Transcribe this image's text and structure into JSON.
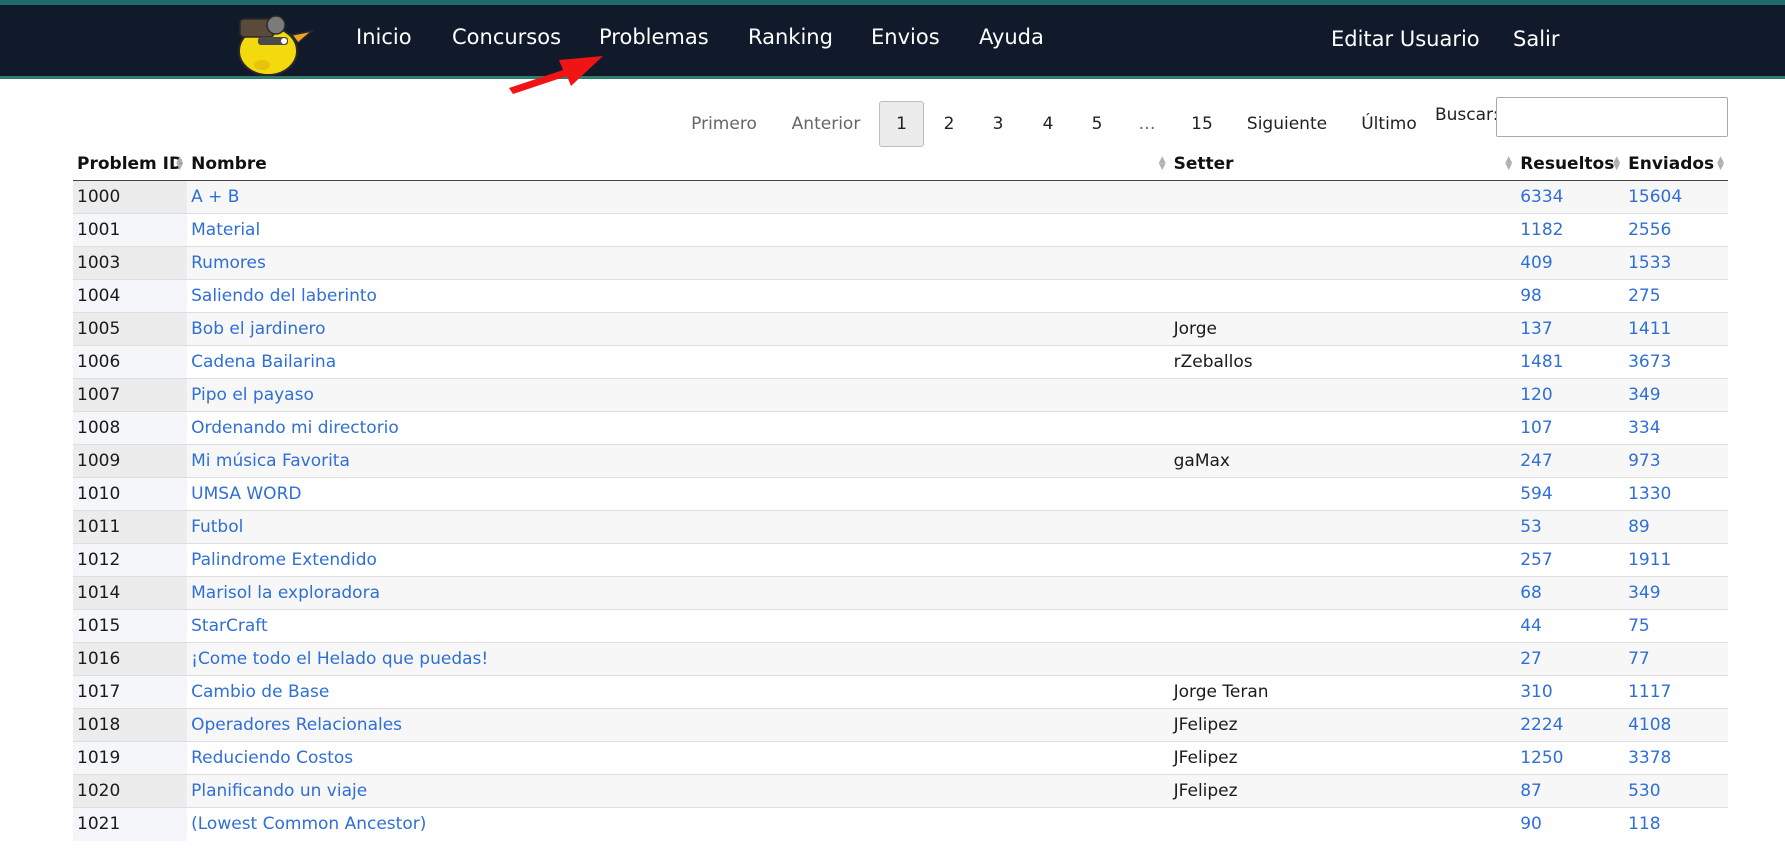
{
  "nav": {
    "links": [
      "Inicio",
      "Concursos",
      "Problemas",
      "Ranking",
      "Envios",
      "Ayuda"
    ],
    "edit_user": "Editar Usuario",
    "logout": "Salir"
  },
  "pagination": {
    "first": "Primero",
    "previous": "Anterior",
    "pages": [
      "1",
      "2",
      "3",
      "4",
      "5",
      "…",
      "15"
    ],
    "next": "Siguiente",
    "last": "Último"
  },
  "search": {
    "label": "Buscar:",
    "value": ""
  },
  "table": {
    "headers": [
      "Problem ID",
      "Nombre",
      "Setter",
      "Resueltos",
      "Enviados"
    ],
    "rows": [
      {
        "id": "1000",
        "name": "A + B",
        "setter": "",
        "solved": "6334",
        "sent": "15604"
      },
      {
        "id": "1001",
        "name": "Material",
        "setter": "",
        "solved": "1182",
        "sent": "2556"
      },
      {
        "id": "1003",
        "name": "Rumores",
        "setter": "",
        "solved": "409",
        "sent": "1533"
      },
      {
        "id": "1004",
        "name": "Saliendo del laberinto",
        "setter": "",
        "solved": "98",
        "sent": "275"
      },
      {
        "id": "1005",
        "name": "Bob el jardinero",
        "setter": "Jorge",
        "solved": "137",
        "sent": "1411"
      },
      {
        "id": "1006",
        "name": "Cadena Bailarina",
        "setter": "rZeballos",
        "solved": "1481",
        "sent": "3673"
      },
      {
        "id": "1007",
        "name": "Pipo el payaso",
        "setter": "",
        "solved": "120",
        "sent": "349"
      },
      {
        "id": "1008",
        "name": "Ordenando mi directorio",
        "setter": "",
        "solved": "107",
        "sent": "334"
      },
      {
        "id": "1009",
        "name": "Mi música Favorita",
        "setter": "gaMax",
        "solved": "247",
        "sent": "973"
      },
      {
        "id": "1010",
        "name": "UMSA WORD",
        "setter": "",
        "solved": "594",
        "sent": "1330"
      },
      {
        "id": "1011",
        "name": "Futbol",
        "setter": "",
        "solved": "53",
        "sent": "89"
      },
      {
        "id": "1012",
        "name": "Palindrome Extendido",
        "setter": "",
        "solved": "257",
        "sent": "1911"
      },
      {
        "id": "1014",
        "name": "Marisol la exploradora",
        "setter": "",
        "solved": "68",
        "sent": "349"
      },
      {
        "id": "1015",
        "name": "StarCraft",
        "setter": "",
        "solved": "44",
        "sent": "75"
      },
      {
        "id": "1016",
        "name": "¡Come todo el Helado que puedas!",
        "setter": "",
        "solved": "27",
        "sent": "77"
      },
      {
        "id": "1017",
        "name": "Cambio de Base",
        "setter": "Jorge Teran",
        "solved": "310",
        "sent": "1117"
      },
      {
        "id": "1018",
        "name": "Operadores Relacionales",
        "setter": "JFelipez",
        "solved": "2224",
        "sent": "4108"
      },
      {
        "id": "1019",
        "name": "Reduciendo Costos",
        "setter": "JFelipez",
        "solved": "1250",
        "sent": "3378"
      },
      {
        "id": "1020",
        "name": "Planificando un viaje",
        "setter": "JFelipez",
        "solved": "87",
        "sent": "530"
      },
      {
        "id": "1021",
        "name": "(Lowest Common Ancestor)",
        "setter": "",
        "solved": "90",
        "sent": "118"
      }
    ]
  }
}
